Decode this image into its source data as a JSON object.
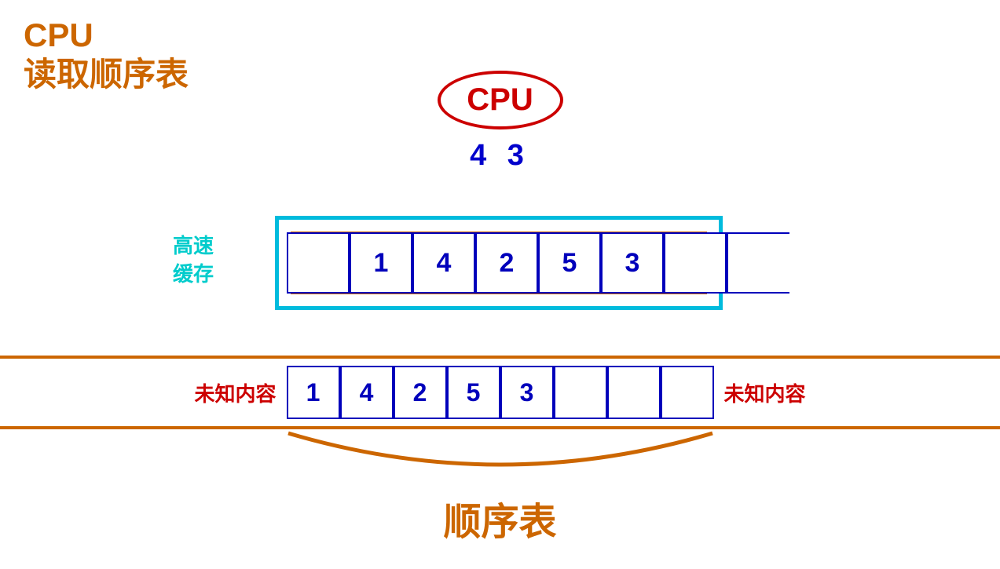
{
  "title": {
    "line1": "CPU",
    "line2": "读取顺序表"
  },
  "cpu_oval": {
    "label": "CPU"
  },
  "cpu_number": "4  3",
  "cache_label": "高速\n缓存",
  "cache_cells": [
    "1",
    "4",
    "2",
    "5",
    "3",
    "",
    ""
  ],
  "memory_cells": [
    "1",
    "4",
    "2",
    "5",
    "3",
    "",
    "",
    ""
  ],
  "unknown_left": "未知内容",
  "unknown_right": "未知内容",
  "seq_label": "顺序表",
  "colors": {
    "orange": "#cc6600",
    "blue": "#0000cc",
    "red": "#cc0000",
    "cyan": "#00bbdd"
  }
}
